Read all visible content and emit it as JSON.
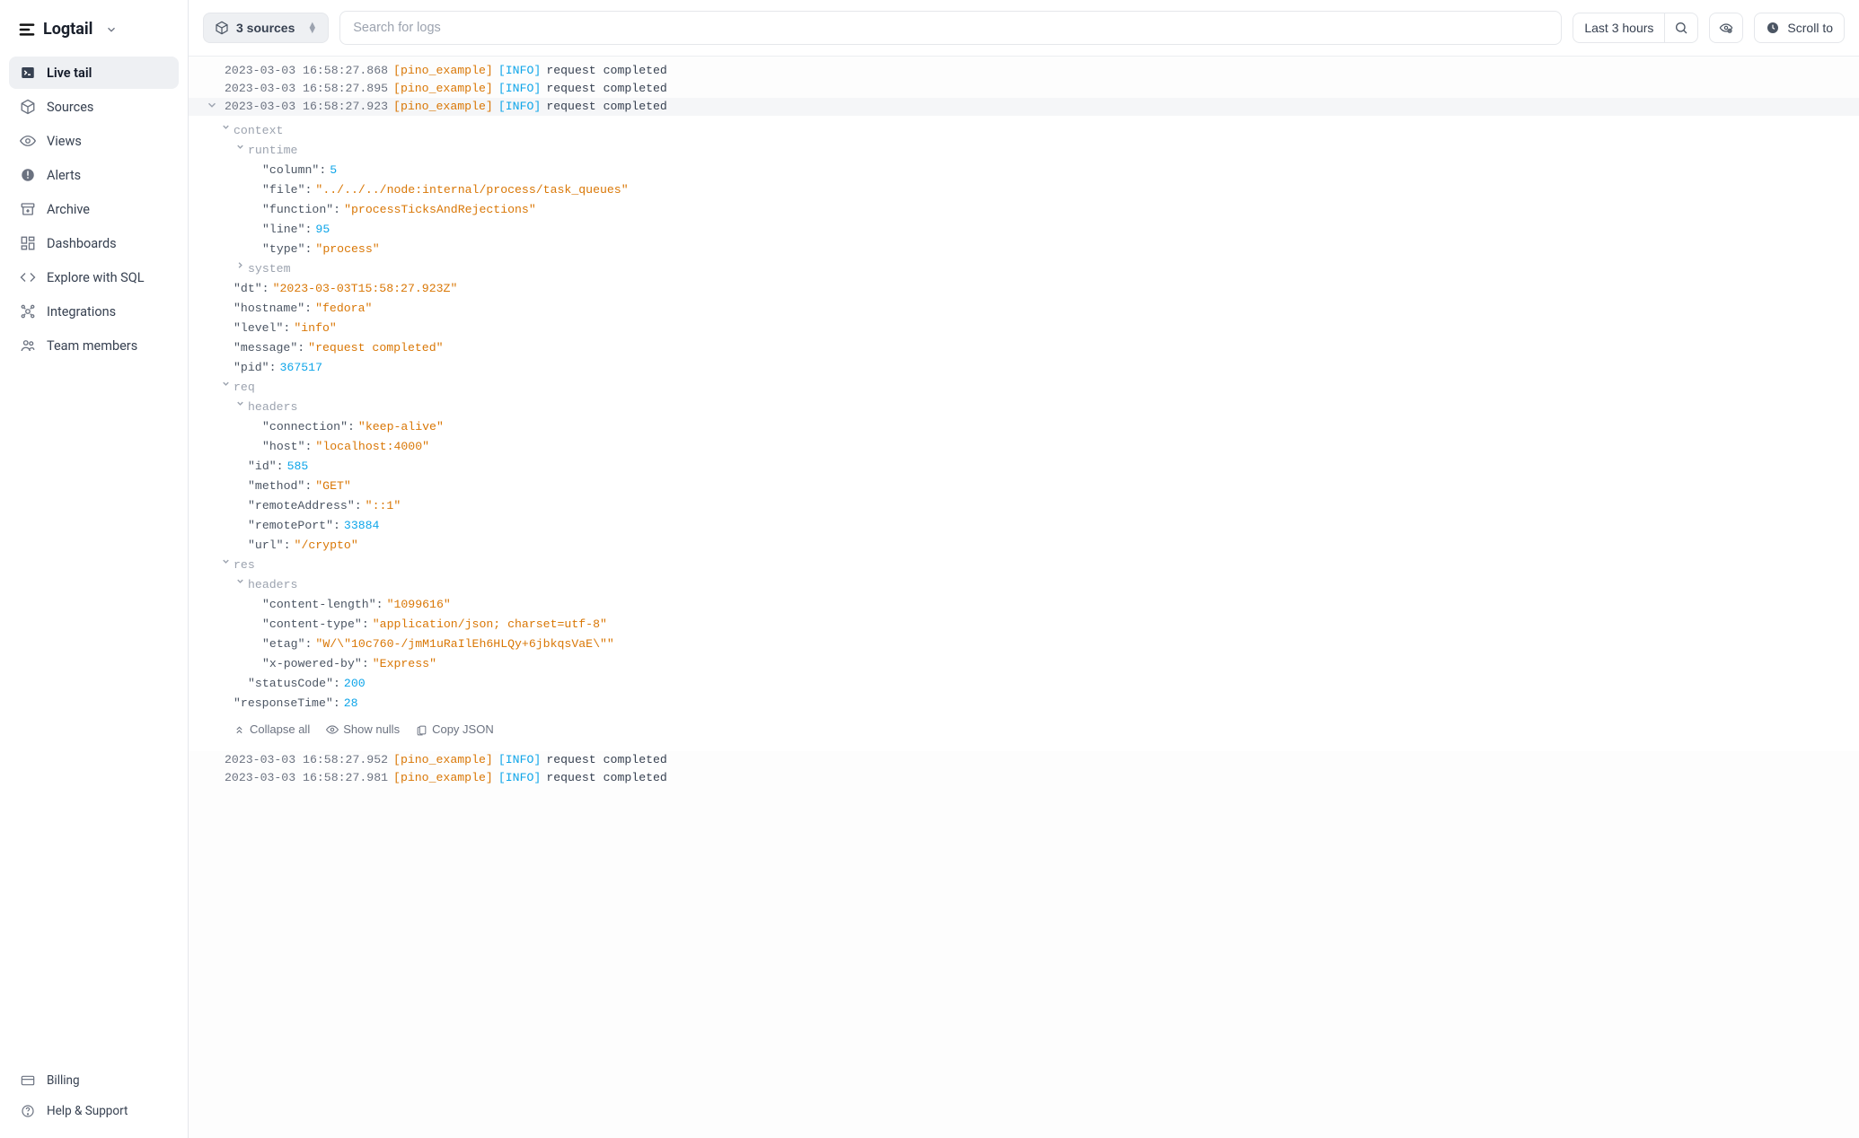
{
  "brand": "Logtail",
  "sidebar": {
    "items": [
      {
        "label": "Live tail",
        "icon": "terminal"
      },
      {
        "label": "Sources",
        "icon": "cube"
      },
      {
        "label": "Views",
        "icon": "eye"
      },
      {
        "label": "Alerts",
        "icon": "alert"
      },
      {
        "label": "Archive",
        "icon": "archive"
      },
      {
        "label": "Dashboards",
        "icon": "dashboard"
      },
      {
        "label": "Explore with SQL",
        "icon": "code"
      },
      {
        "label": "Integrations",
        "icon": "integrations"
      },
      {
        "label": "Team members",
        "icon": "users"
      }
    ],
    "bottom": [
      {
        "label": "Billing",
        "icon": "card"
      },
      {
        "label": "Help & Support",
        "icon": "help"
      }
    ]
  },
  "toolbar": {
    "sources_label": "3 sources",
    "search_placeholder": "Search for logs",
    "timerange_label": "Last 3 hours",
    "scrollto_label": "Scroll to"
  },
  "logs": {
    "before": [
      {
        "ts": "2023-03-03 16:58:27.868",
        "src": "[pino_example]",
        "lvl": "[INFO]",
        "msg": "request completed"
      },
      {
        "ts": "2023-03-03 16:58:27.895",
        "src": "[pino_example]",
        "lvl": "[INFO]",
        "msg": "request completed"
      }
    ],
    "expanded": {
      "ts": "2023-03-03 16:58:27.923",
      "src": "[pino_example]",
      "lvl": "[INFO]",
      "msg": "request completed"
    },
    "after": [
      {
        "ts": "2023-03-03 16:58:27.952",
        "src": "[pino_example]",
        "lvl": "[INFO]",
        "msg": "request completed"
      },
      {
        "ts": "2023-03-03 16:58:27.981",
        "src": "[pino_example]",
        "lvl": "[INFO]",
        "msg": "request completed"
      }
    ]
  },
  "json": {
    "context_label": "context",
    "runtime_label": "runtime",
    "system_label": "system",
    "req_label": "req",
    "req_headers_label": "headers",
    "res_label": "res",
    "res_headers_label": "headers",
    "runtime": {
      "column_k": "column",
      "column_v": "5",
      "file_k": "file",
      "file_v": "../../../node:internal/process/task_queues",
      "function_k": "function",
      "function_v": "processTicksAndRejections",
      "line_k": "line",
      "line_v": "95",
      "type_k": "type",
      "type_v": "process"
    },
    "top": {
      "dt_k": "dt",
      "dt_v": "2023-03-03T15:58:27.923Z",
      "hostname_k": "hostname",
      "hostname_v": "fedora",
      "level_k": "level",
      "level_v": "info",
      "message_k": "message",
      "message_v": "request completed",
      "pid_k": "pid",
      "pid_v": "367517",
      "responseTime_k": "responseTime",
      "responseTime_v": "28"
    },
    "req": {
      "h_connection_k": "connection",
      "h_connection_v": "keep-alive",
      "h_host_k": "host",
      "h_host_v": "localhost:4000",
      "id_k": "id",
      "id_v": "585",
      "method_k": "method",
      "method_v": "GET",
      "remoteAddress_k": "remoteAddress",
      "remoteAddress_v": "::1",
      "remotePort_k": "remotePort",
      "remotePort_v": "33884",
      "url_k": "url",
      "url_v": "/crypto"
    },
    "res": {
      "h_cl_k": "content-length",
      "h_cl_v": "1099616",
      "h_ct_k": "content-type",
      "h_ct_v": "application/json; charset=utf-8",
      "h_etag_k": "etag",
      "h_etag_v": "W/\\\"10c760-/jmM1uRaIlEh6HLQy+6jbkqsVaE\\\"",
      "h_xpb_k": "x-powered-by",
      "h_xpb_v": "Express",
      "statusCode_k": "statusCode",
      "statusCode_v": "200"
    }
  },
  "actions": {
    "collapse_all": "Collapse all",
    "show_nulls": "Show nulls",
    "copy_json": "Copy JSON"
  }
}
